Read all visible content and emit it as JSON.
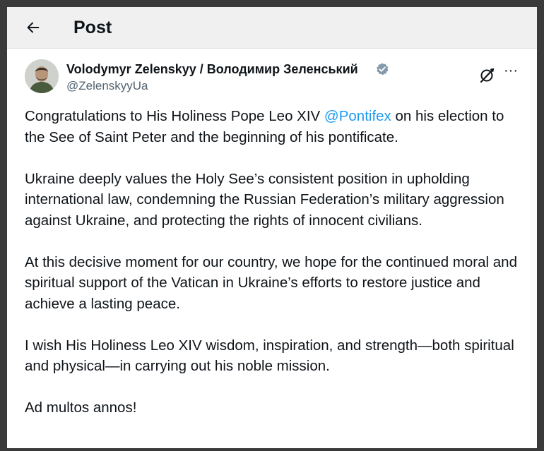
{
  "topbar": {
    "back_icon": "arrow-left-icon",
    "title": "Post"
  },
  "post": {
    "author_name": "Volodymyr Zelenskyy / Володимир Зеленський",
    "handle": "@ZelenskyyUa",
    "verified_icon": "verified-badge-icon",
    "verified_color": "#829aab",
    "grok_icon": "grok-icon",
    "more_icon": "more-horizontal-icon",
    "more_glyph": "···",
    "link_color": "#1d9bf0",
    "paragraphs": {
      "p1_before": "Congratulations to His Holiness Pope Leo XIV ",
      "p1_mention": "@Pontifex",
      "p1_after": " on his election to the See of Saint Peter and the beginning of his pontificate.",
      "p2": "Ukraine deeply values the Holy See’s consistent position in upholding international law, condemning the Russian Federation’s military aggression against Ukraine, and protecting the rights of innocent civilians.",
      "p3": "At this decisive moment for our country, we hope for the continued moral and spiritual support of the Vatican in Ukraine’s efforts to restore justice and achieve a lasting peace.",
      "p4": "I wish His Holiness Leo XIV wisdom, inspiration, and strength—both spiritual and physical—in carrying out his noble mission.",
      "p5": "Ad multos annos!"
    }
  }
}
